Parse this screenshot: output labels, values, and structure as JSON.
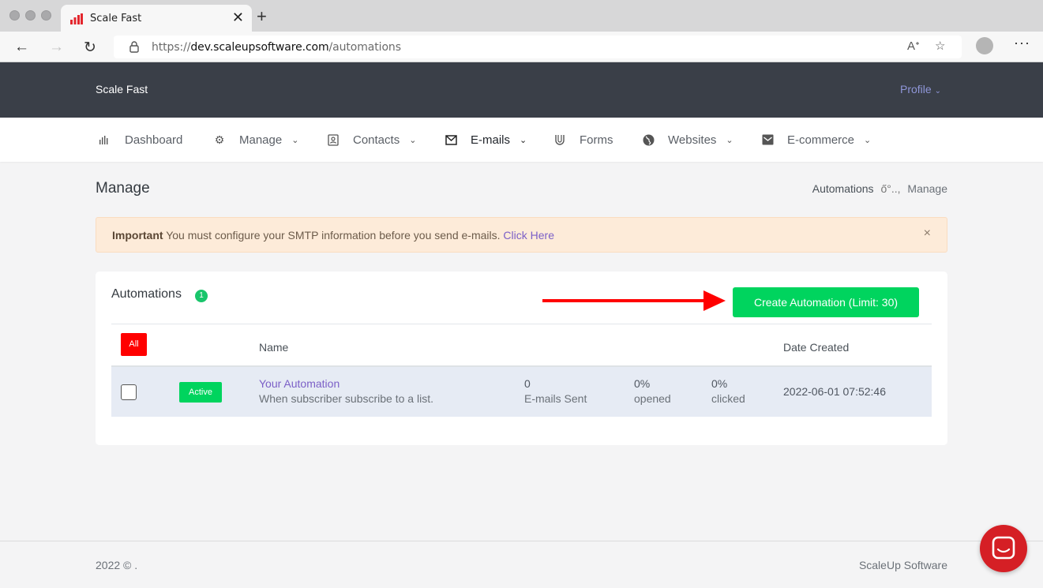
{
  "browser": {
    "tab_title": "Scale Fast",
    "url_prefix": "https://",
    "url_domain": "dev.scaleupsoftware.com",
    "url_path": "/automations"
  },
  "header": {
    "brand": "Scale Fast",
    "profile_label": "Profile"
  },
  "menu": {
    "items": [
      {
        "label": "Dashboard",
        "icon": "bar-chart-icon"
      },
      {
        "label": "Manage",
        "icon": "gear-icon"
      },
      {
        "label": "Contacts",
        "icon": "contact-card-icon"
      },
      {
        "label": "E-mails",
        "icon": "envelope-icon"
      },
      {
        "label": "Forms",
        "icon": "magnet-icon"
      },
      {
        "label": "Websites",
        "icon": "globe-icon"
      },
      {
        "label": "E-commerce",
        "icon": "mail-box-icon"
      }
    ]
  },
  "page": {
    "title": "Manage",
    "breadcrumb": [
      "Automations",
      "ő°..,",
      "Manage"
    ]
  },
  "alert": {
    "strong": "Important",
    "text": "You must configure your SMTP information before you send e-mails.",
    "link": "Click Here",
    "close": "×"
  },
  "card": {
    "title": "Automations",
    "count": "1",
    "create_button": "Create Automation (Limit: 30)",
    "filter_all": "All",
    "columns": {
      "name": "Name",
      "date_created": "Date Created"
    },
    "rows": [
      {
        "status": "Active",
        "name": "Your Automation",
        "description": "When subscriber subscribe to a list.",
        "emails_sent_value": "0",
        "emails_sent_label": "E-mails Sent",
        "opened_value": "0%",
        "opened_label": "opened",
        "clicked_value": "0%",
        "clicked_label": "clicked",
        "date_created": "2022-06-01 07:52:46"
      }
    ]
  },
  "footer": {
    "copyright": "2022 © .",
    "company": "ScaleUp Software"
  },
  "colors": {
    "accent_green": "#00d45e",
    "header_dark": "#3a3f48",
    "alert_bg": "#fdebd9",
    "annotation_red": "#ff0000"
  }
}
